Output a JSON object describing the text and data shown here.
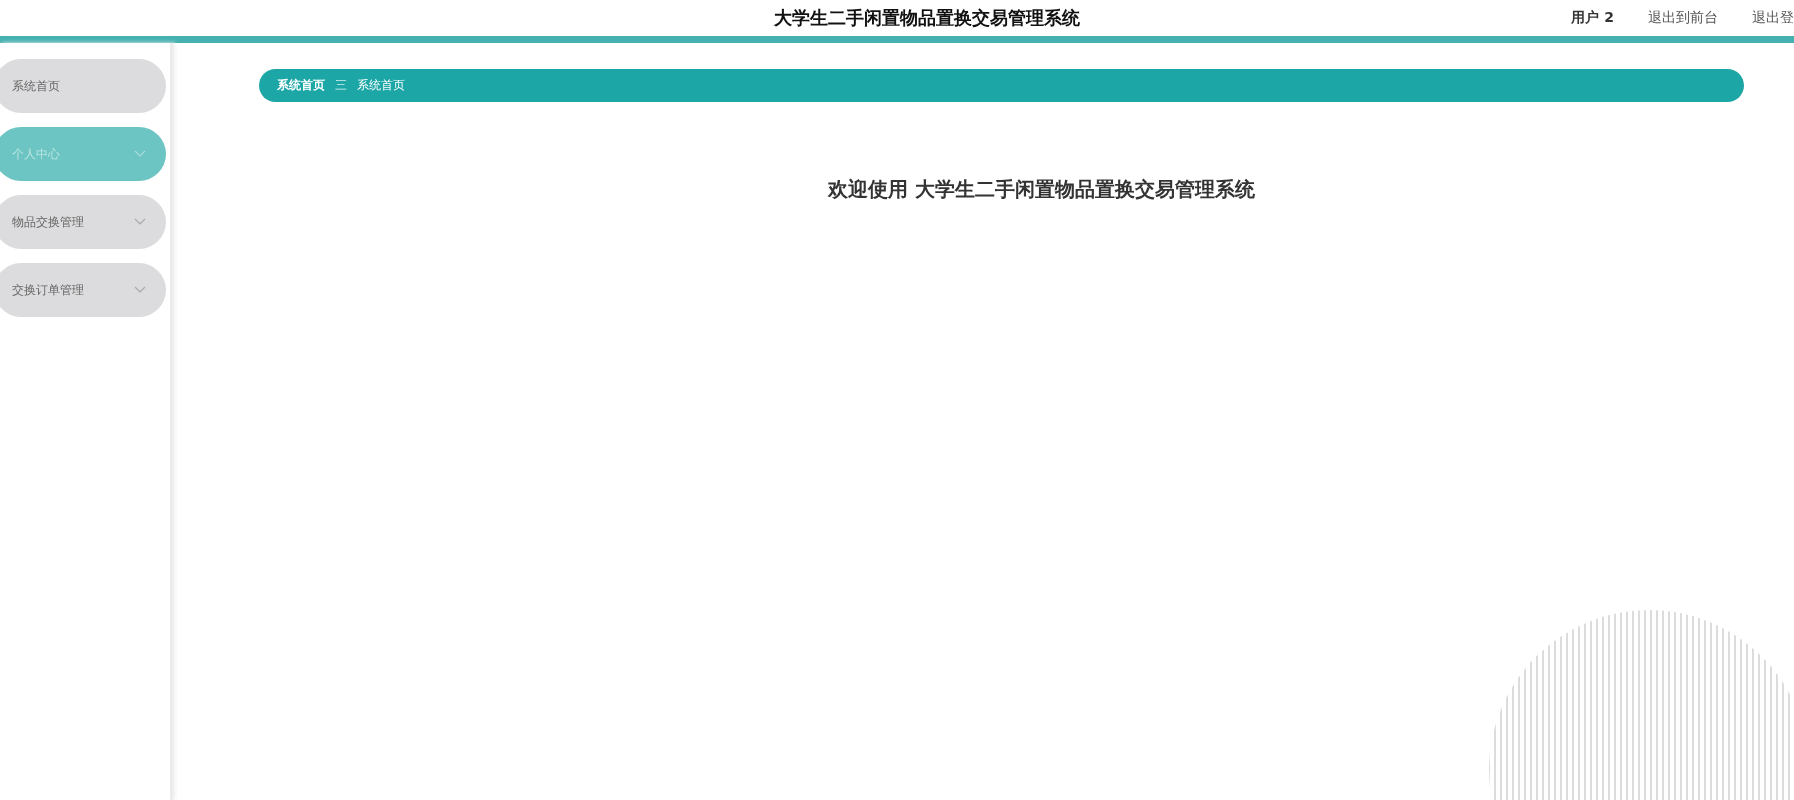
{
  "header": {
    "title": "大学生二手闲置物品置换交易管理系统",
    "links": [
      {
        "label": "用户 2",
        "kind": "user"
      },
      {
        "label": "退出到前台",
        "kind": "link"
      },
      {
        "label": "退出登",
        "kind": "link"
      }
    ]
  },
  "sidebar": {
    "items": [
      {
        "label": "系统首页",
        "selected": false,
        "has_submenu": false
      },
      {
        "label": "个人中心",
        "selected": true,
        "has_submenu": true
      },
      {
        "label": "物品交换管理",
        "selected": false,
        "has_submenu": true
      },
      {
        "label": "交换订单管理",
        "selected": false,
        "has_submenu": true
      }
    ]
  },
  "breadcrumb": {
    "items": [
      "系统首页",
      "系统首页"
    ],
    "separator": "三"
  },
  "welcome": "欢迎使用 大学生二手闲置物品置换交易管理系统"
}
